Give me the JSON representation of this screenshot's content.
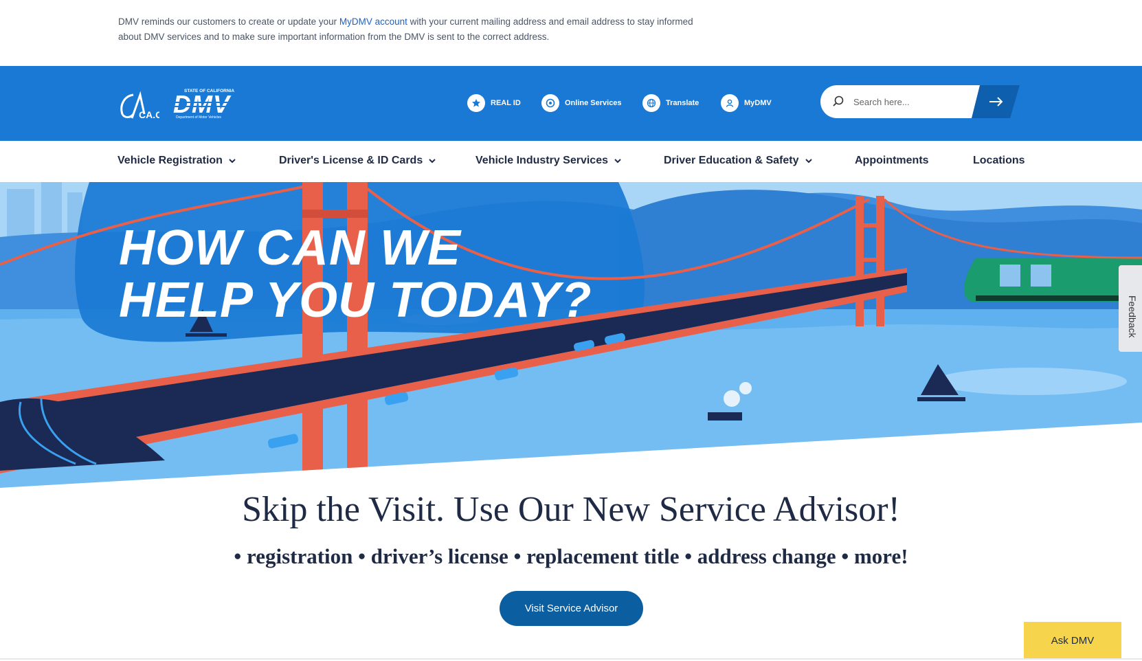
{
  "alert": {
    "text_before": "DMV reminds our customers to create or update your ",
    "link": "MyDMV account",
    "text_after": " with your current mailing address and email address to stay informed about DMV services and to make sure important information from the DMV is sent to the correct address."
  },
  "header": {
    "logo_ca": "CA.GOV",
    "logo_dmv_top": "STATE OF CALIFORNIA",
    "logo_dmv": "DMV",
    "logo_dmv_sub": "Department of Motor Vehicles",
    "util": [
      {
        "label": "REAL ID",
        "icon": "star-icon"
      },
      {
        "label": "Online Services",
        "icon": "online-services-icon"
      },
      {
        "label": "Translate",
        "icon": "globe-icon"
      },
      {
        "label": "MyDMV",
        "icon": "user-icon"
      }
    ],
    "search_placeholder": "Search here..."
  },
  "nav": [
    {
      "label": "Vehicle Registration",
      "dropdown": true
    },
    {
      "label": "Driver's License & ID Cards",
      "dropdown": true
    },
    {
      "label": "Vehicle Industry Services",
      "dropdown": true
    },
    {
      "label": "Driver Education & Safety",
      "dropdown": true
    },
    {
      "label": "Appointments",
      "dropdown": false
    },
    {
      "label": "Locations",
      "dropdown": false
    }
  ],
  "hero": {
    "line1": "HOW CAN WE",
    "line2": "HELP YOU TODAY?"
  },
  "feedback": "Feedback",
  "promo": {
    "title": "Skip the Visit. Use Our New Service Advisor!",
    "subtitle": "• registration • driver’s license • replacement title • address change • more!",
    "cta": "Visit Service Advisor"
  },
  "ask_dmv": "Ask DMV",
  "colors": {
    "header_blue": "#1a79d4",
    "cta_blue": "#0b5fa0",
    "ask_yellow": "#f6d54d",
    "bridge_red": "#e8604a"
  }
}
